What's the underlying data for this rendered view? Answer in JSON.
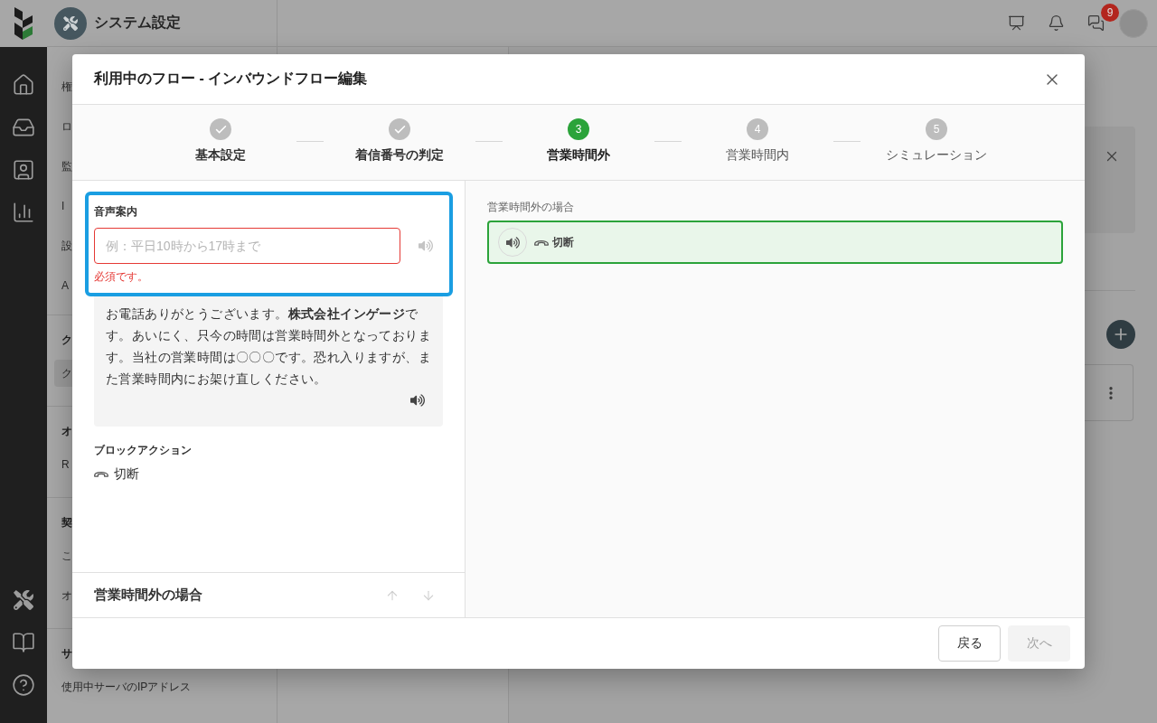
{
  "app_header": {
    "title": "システム設定",
    "chat_badge": "9"
  },
  "sidebar": {
    "groups": [
      {
        "items": [
          {
            "label": "権",
            "selected": false
          },
          {
            "label": "ロ",
            "selected": false
          },
          {
            "label": "監",
            "selected": false
          },
          {
            "label": "I",
            "selected": false
          },
          {
            "label": "設",
            "selected": false
          },
          {
            "label": "A",
            "selected": false
          }
        ]
      },
      {
        "heading": "ク",
        "items": [
          {
            "label": "ク",
            "selected": true
          }
        ]
      },
      {
        "heading": "オ",
        "items": [
          {
            "label": "R",
            "selected": false
          }
        ]
      },
      {
        "heading": "契",
        "items": [
          {
            "label": "こ",
            "selected": false
          },
          {
            "label": "オ",
            "selected": false
          }
        ]
      },
      {
        "heading": "サ",
        "items": [
          {
            "label": "使用中サーバのIPアドレス",
            "selected": false
          }
        ]
      }
    ]
  },
  "dialog": {
    "title": "利用中のフロー - インバウンドフロー編集",
    "steps": [
      {
        "label": "基本設定",
        "done": true,
        "selected": false
      },
      {
        "label": "着信番号の判定",
        "done": true,
        "selected": false
      },
      {
        "label": "営業時間外",
        "number": "3",
        "done": false,
        "selected": true
      },
      {
        "label": "営業時間内",
        "number": "4",
        "done": false,
        "selected": false
      },
      {
        "label": "シミュレーション",
        "number": "5",
        "done": false,
        "selected": false
      }
    ],
    "editor": {
      "highlighted": true,
      "label": "音声案内",
      "placeholder": "例：平日10時から17時まで",
      "invalid": true,
      "error": "必須です。",
      "play_disabled": true,
      "message": "お電話ありがとうございます。**株式会社インゲージ**です。あいにく、只今の時間は営業時間外となっております。当社の営業時間は〇〇〇です。恐れ入りますが、また営業時間内にお架け直しください。",
      "action_label": "ブロックアクション",
      "action": "切断"
    },
    "section": {
      "title": "営業時間外の場合",
      "up_disabled": true,
      "down_disabled": true
    },
    "preview": {
      "label": "営業時間外の場合",
      "blocks": [
        {
          "action": "切断",
          "selected": true
        }
      ]
    },
    "buttons": [
      {
        "label": "戻る",
        "disabled": false
      },
      {
        "label": "次へ",
        "disabled": true
      }
    ]
  }
}
